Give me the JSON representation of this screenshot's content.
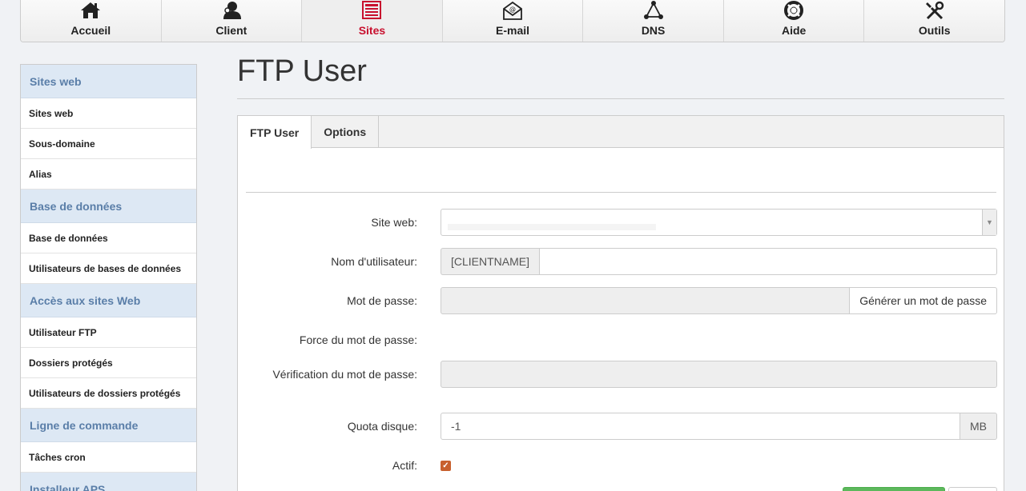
{
  "nav": {
    "items": [
      {
        "label": "Accueil",
        "icon": "home-icon"
      },
      {
        "label": "Client",
        "icon": "user-icon"
      },
      {
        "label": "Sites",
        "icon": "sites-icon",
        "active": true
      },
      {
        "label": "E-mail",
        "icon": "mail-icon"
      },
      {
        "label": "DNS",
        "icon": "dns-icon"
      },
      {
        "label": "Aide",
        "icon": "lifebuoy-icon"
      },
      {
        "label": "Outils",
        "icon": "tools-icon"
      }
    ],
    "active_color": "#c8102e"
  },
  "sidebar": {
    "sections": [
      {
        "title": "Sites web",
        "items": [
          "Sites web",
          "Sous-domaine",
          "Alias"
        ]
      },
      {
        "title": "Base de données",
        "items": [
          "Base de données",
          "Utilisateurs de bases de données"
        ]
      },
      {
        "title": "Accès aux sites Web",
        "items": [
          "Utilisateur FTP",
          "Dossiers protégés",
          "Utilisateurs de dossiers protégés"
        ]
      },
      {
        "title": "Ligne de commande",
        "items": [
          "Tâches cron"
        ]
      },
      {
        "title": "Installeur APS",
        "items": []
      }
    ]
  },
  "page": {
    "title": "FTP User",
    "tabs": [
      {
        "label": "FTP User",
        "active": true
      },
      {
        "label": "Options"
      }
    ]
  },
  "form": {
    "site_web_label": "Site web:",
    "site_web_value": "",
    "username_label": "Nom d'utilisateur:",
    "username_prefix": "[CLIENTNAME]",
    "username_value": "",
    "password_label": "Mot de passe:",
    "password_value": "",
    "generate_button": "Générer un mot de passe",
    "strength_label": "Force du mot de passe:",
    "verify_label": "Vérification du mot de passe:",
    "verify_value": "",
    "quota_label": "Quota disque:",
    "quota_value": "-1",
    "quota_unit": "MB",
    "active_label": "Actif:",
    "active_checked": true
  },
  "colors": {
    "sidebar_header_bg": "#dde8f4",
    "sidebar_header_text": "#5a7ea8",
    "checkbox": "#c8602e",
    "save_button": "#5cb85c"
  }
}
